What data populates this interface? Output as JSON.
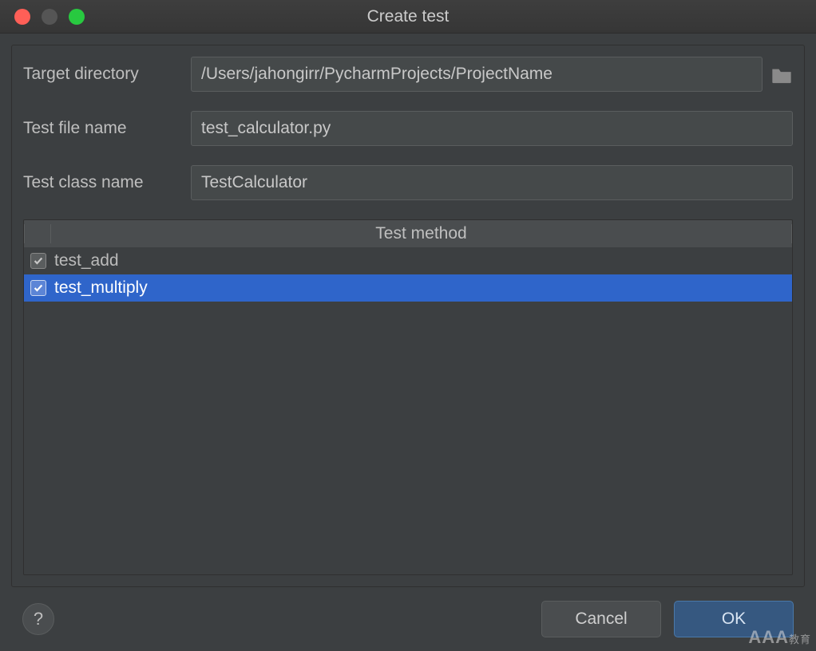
{
  "window": {
    "title": "Create test"
  },
  "form": {
    "target_directory_label": "Target directory",
    "target_directory_value": "/Users/jahongirr/PycharmProjects/ProjectName",
    "test_file_name_label": "Test file name",
    "test_file_name_value": "test_calculator.py",
    "test_class_name_label": "Test class name",
    "test_class_name_value": "TestCalculator"
  },
  "table": {
    "header": "Test method",
    "rows": [
      {
        "name": "test_add",
        "checked": true,
        "selected": false
      },
      {
        "name": "test_multiply",
        "checked": true,
        "selected": true
      }
    ]
  },
  "footer": {
    "help_label": "?",
    "cancel_label": "Cancel",
    "ok_label": "OK"
  },
  "watermark": {
    "big": "AAA",
    "small": "教育"
  }
}
